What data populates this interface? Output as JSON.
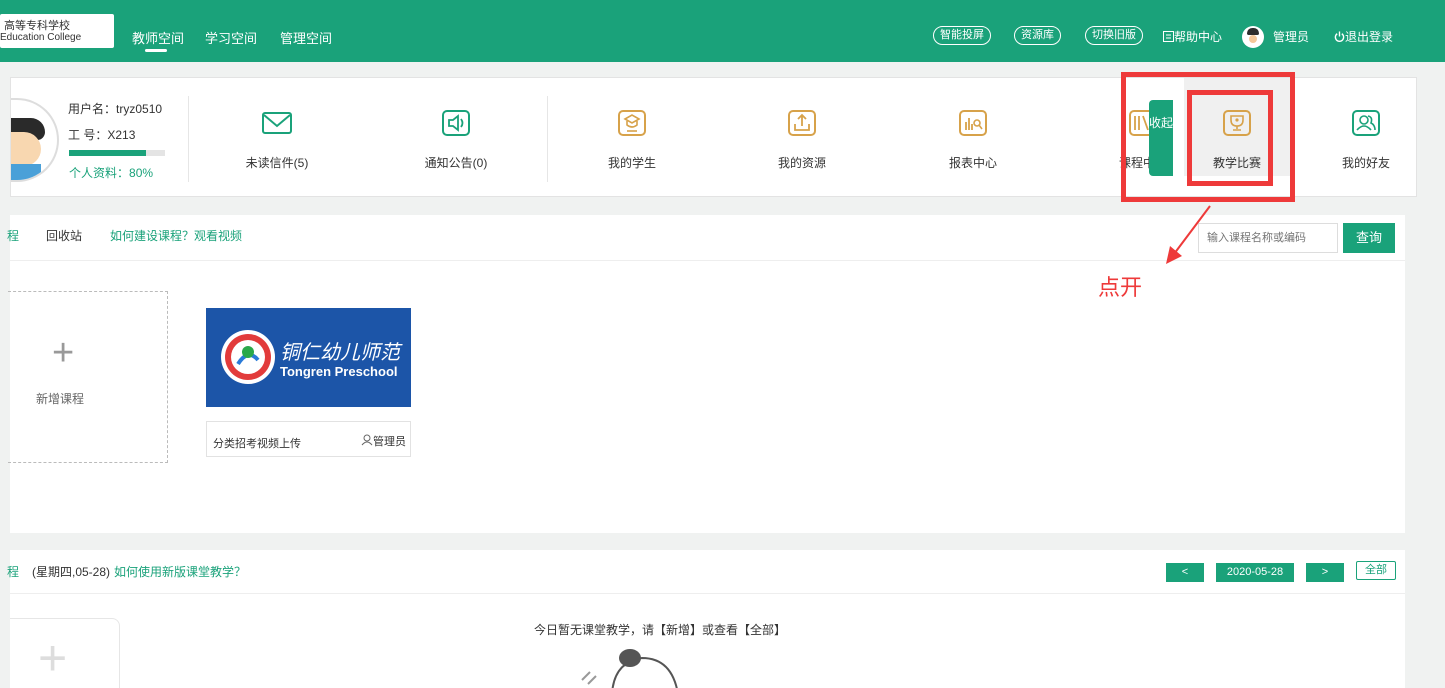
{
  "header": {
    "logo_cn": "高等专科学校",
    "logo_en": "Education College",
    "nav": [
      "教师空间",
      "学习空间",
      "管理空间"
    ],
    "pills": [
      "智能投屏",
      "资源库",
      "切换旧版"
    ],
    "help": "帮助中心",
    "user": "管理员",
    "logout": "退出登录"
  },
  "profile": {
    "username_label": "用户名：",
    "username": "tryz0510",
    "id_label": "工  号：",
    "id": "X213",
    "completeness_label": "个人资料：",
    "completeness": "80%",
    "completeness_value": 0.8,
    "items": [
      {
        "label": "未读信件(5)",
        "icon": "mail-icon"
      },
      {
        "label": "通知公告(0)",
        "icon": "speaker-icon"
      },
      {
        "label": "我的学生",
        "icon": "graduate-icon"
      },
      {
        "label": "我的资源",
        "icon": "upload-icon"
      },
      {
        "label": "报表中心",
        "icon": "chart-icon"
      },
      {
        "label": "课程中心",
        "icon": "books-icon"
      },
      {
        "label": "教学比赛",
        "icon": "trophy-icon"
      },
      {
        "label": "我的好友",
        "icon": "friends-icon"
      }
    ],
    "collapse": "收起"
  },
  "annotation": {
    "text": "点开"
  },
  "courses": {
    "tab_active": "程",
    "recycle": "回收站",
    "howto": "如何建设课程？观看视频",
    "search_placeholder": "输入课程名称或编码",
    "search_button": "查询",
    "add_label": "新增课程",
    "card": {
      "thumb_title": "铜仁幼儿师范",
      "thumb_sub": "Tongren Preschool",
      "name": "分类招考视频上传",
      "owner": "管理员"
    }
  },
  "classroom": {
    "tab_active": "程",
    "date_info": "(星期四,05-28)",
    "howto": "如何使用新版课堂教学？",
    "prev": "<",
    "date": "2020-05-28",
    "next": ">",
    "all": "全部",
    "empty": "今日暂无课堂教学，请【新增】或查看【全部】"
  },
  "colors": {
    "brand": "#1aa27a",
    "annotation": "#ee3a3a",
    "icon_gold": "#d7a24a"
  }
}
